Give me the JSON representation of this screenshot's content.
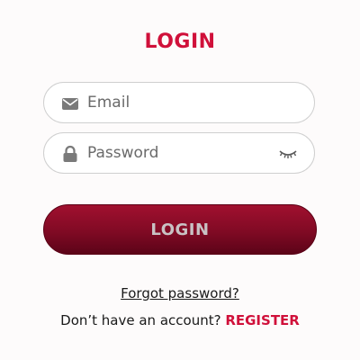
{
  "title": "LOGIN",
  "email": {
    "placeholder": "Email",
    "value": "",
    "icon": "envelope-icon"
  },
  "password": {
    "placeholder": "Password",
    "value": "",
    "icon": "lock-icon",
    "toggle_icon": "eye-closed-icon"
  },
  "login_button": {
    "label": "LOGIN"
  },
  "forgot_password": {
    "label": "Forgot password?"
  },
  "register": {
    "prompt": "Don’t have an account?",
    "link": "REGISTER"
  },
  "colors": {
    "accent": "#d0103a",
    "button_top": "#a0102f",
    "button_bottom": "#5c0418",
    "button_text": "#c9c2c4",
    "icon_gray": "#7a7a7a"
  }
}
